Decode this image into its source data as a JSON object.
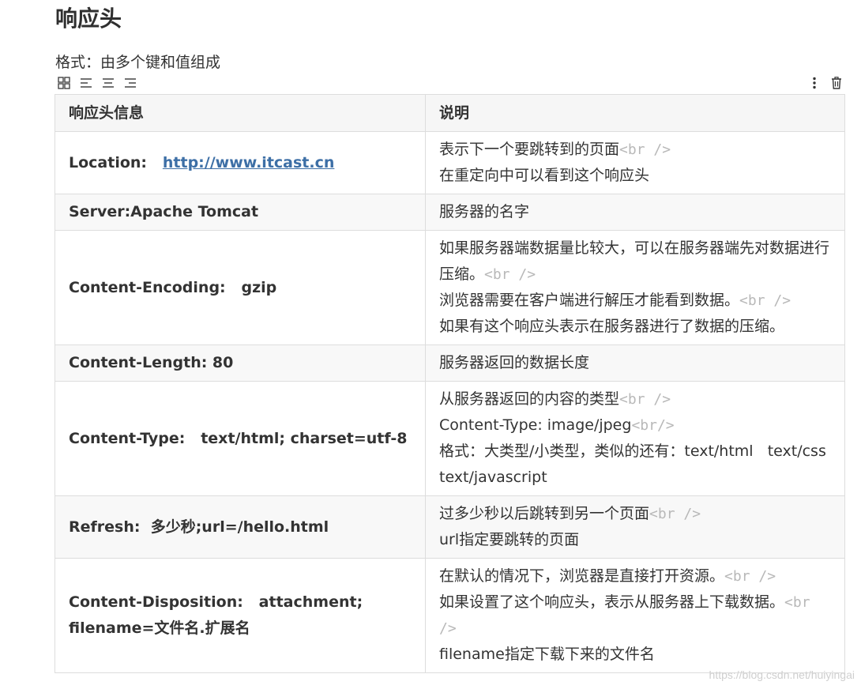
{
  "title": "响应头",
  "format_text": "格式：由多个键和值组成",
  "toolbar": {
    "left_icons": [
      "grid-icon",
      "align-left-icon",
      "align-center-icon",
      "align-right-icon"
    ],
    "right_icons": [
      "more-vertical-icon",
      "trash-icon"
    ]
  },
  "table": {
    "headers": [
      "响应头信息",
      "说明"
    ],
    "rows": [
      {
        "name_prefix": "Location:   ",
        "name_link": "http://www.itcast.cn",
        "desc_lines": [
          {
            "text": "表示下一个要跳转到的页面",
            "br": "<br />"
          },
          {
            "text": "在重定向中可以看到这个响应头",
            "br": ""
          }
        ]
      },
      {
        "name_prefix": "Server:Apache Tomcat",
        "name_link": "",
        "desc_lines": [
          {
            "text": "服务器的名字",
            "br": ""
          }
        ]
      },
      {
        "name_prefix": "Content-Encoding:   gzip",
        "name_link": "",
        "desc_lines": [
          {
            "text": "如果服务器端数据量比较大，可以在服务器端先对数据进行压缩。",
            "br": "<br />"
          },
          {
            "text": "浏览器需要在客户端进行解压才能看到数据。",
            "br": "<br />"
          },
          {
            "text": "如果有这个响应头表示在服务器进行了数据的压缩。",
            "br": ""
          }
        ]
      },
      {
        "name_prefix": "Content-Length: 80",
        "name_link": "",
        "desc_lines": [
          {
            "text": "服务器返回的数据长度",
            "br": ""
          }
        ]
      },
      {
        "name_prefix": "Content-Type:   text/html; charset=utf-8",
        "name_link": "",
        "desc_lines": [
          {
            "text": "从服务器返回的内容的类型",
            "br": "<br />"
          },
          {
            "text": "Content-Type: image/jpeg",
            "br": "<br/>"
          },
          {
            "text": "格式：大类型/小类型，类似的还有：text/html   text/css text/javascript",
            "br": ""
          }
        ]
      },
      {
        "name_prefix": "Refresh:  多少秒;url=/hello.html",
        "name_link": "",
        "desc_lines": [
          {
            "text": "过多少秒以后跳转到另一个页面",
            "br": "<br />"
          },
          {
            "text": "url指定要跳转的页面",
            "br": ""
          }
        ]
      },
      {
        "name_prefix": "Content-Disposition:   attachment; filename=文件名.扩展名",
        "name_link": "",
        "desc_lines": [
          {
            "text": "在默认的情况下，浏览器是直接打开资源。",
            "br": "<br />"
          },
          {
            "text": "如果设置了这个响应头，表示从服务器上下载数据。",
            "br": "<br />"
          },
          {
            "text": "filename指定下载下来的文件名",
            "br": ""
          }
        ]
      }
    ]
  },
  "watermark": "https://blog.csdn.net/huiyingai"
}
